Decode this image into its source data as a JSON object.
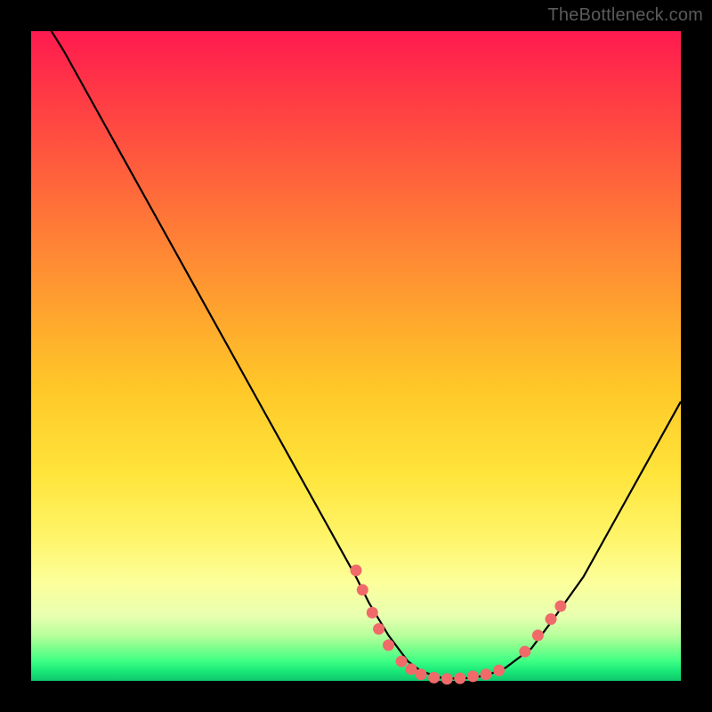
{
  "watermark": "TheBottleneck.com",
  "colors": {
    "curve": "#000000",
    "dot_fill": "#f06a6a",
    "dot_stroke": "#b34343"
  },
  "chart_data": {
    "type": "line",
    "title": "",
    "xlabel": "",
    "ylabel": "",
    "xlim": [
      0,
      100
    ],
    "ylim": [
      0,
      100
    ],
    "series": [
      {
        "name": "bottleneck-curve",
        "x": [
          0,
          5,
          10,
          15,
          20,
          25,
          30,
          35,
          40,
          45,
          50,
          52,
          55,
          58,
          60,
          63,
          66,
          70,
          73,
          77,
          80,
          85,
          90,
          95,
          100
        ],
        "y": [
          105,
          97,
          88,
          79,
          70,
          61,
          52,
          43,
          34,
          25,
          16,
          12,
          7,
          3,
          1.5,
          0.5,
          0.3,
          0.8,
          2,
          5,
          9,
          16,
          25,
          34,
          43
        ]
      }
    ],
    "scatter": [
      {
        "name": "highlight-dots",
        "points": [
          {
            "x": 50,
            "y": 17
          },
          {
            "x": 51,
            "y": 14
          },
          {
            "x": 52.5,
            "y": 10.5
          },
          {
            "x": 53.5,
            "y": 8
          },
          {
            "x": 55,
            "y": 5.5
          },
          {
            "x": 57,
            "y": 3
          },
          {
            "x": 58.5,
            "y": 1.8
          },
          {
            "x": 60,
            "y": 1
          },
          {
            "x": 62,
            "y": 0.5
          },
          {
            "x": 64,
            "y": 0.3
          },
          {
            "x": 66,
            "y": 0.4
          },
          {
            "x": 68,
            "y": 0.7
          },
          {
            "x": 70,
            "y": 1
          },
          {
            "x": 72,
            "y": 1.6
          },
          {
            "x": 76,
            "y": 4.5
          },
          {
            "x": 78,
            "y": 7
          },
          {
            "x": 80,
            "y": 9.5
          },
          {
            "x": 81.5,
            "y": 11.5
          }
        ]
      }
    ]
  }
}
